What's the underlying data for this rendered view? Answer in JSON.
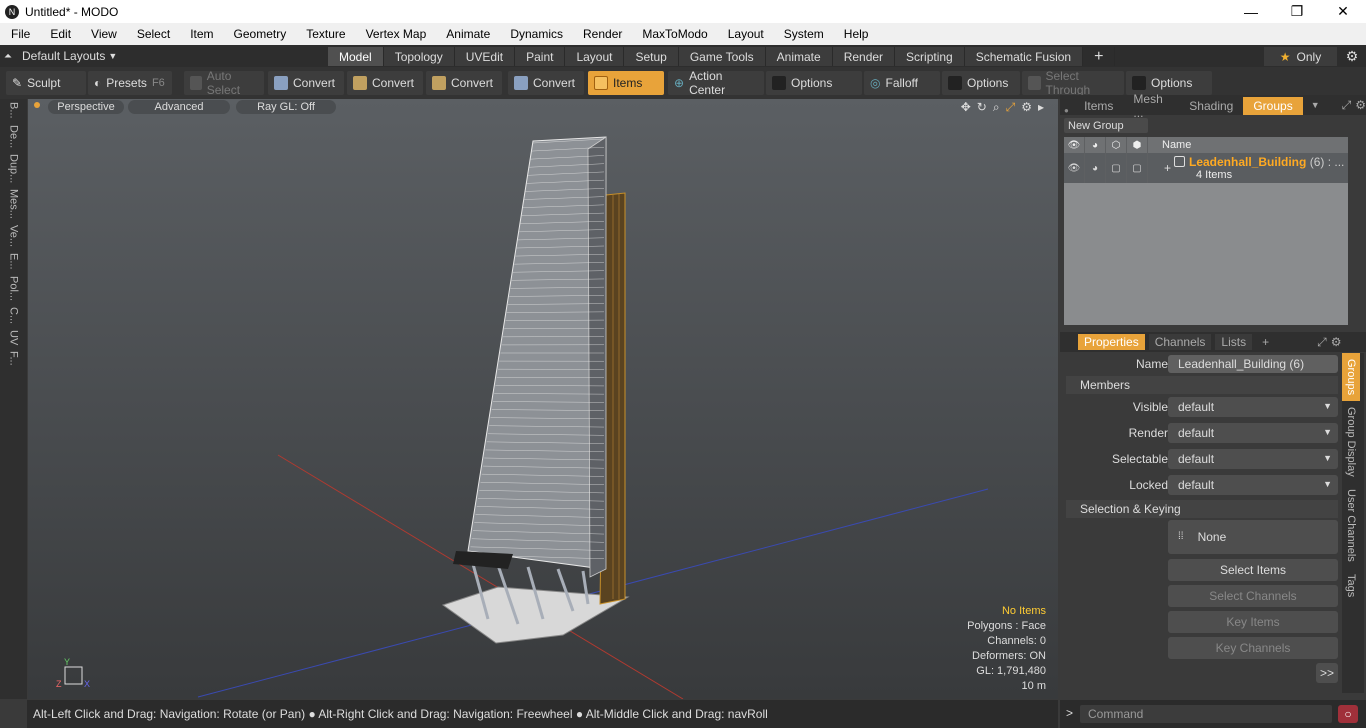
{
  "window": {
    "title": "Untitled* - MODO",
    "logo": "N"
  },
  "menu": [
    "File",
    "Edit",
    "View",
    "Select",
    "Item",
    "Geometry",
    "Texture",
    "Vertex Map",
    "Animate",
    "Dynamics",
    "Render",
    "MaxToModo",
    "Layout",
    "System",
    "Help"
  ],
  "layout_bar": {
    "default_layouts": "Default Layouts",
    "tabs": [
      "Model",
      "Topology",
      "UVEdit",
      "Paint",
      "Layout",
      "Setup",
      "Game Tools",
      "Animate",
      "Render",
      "Scripting",
      "Schematic Fusion"
    ],
    "active_tab": "Model",
    "add": "+",
    "only": "Only"
  },
  "toolbar": {
    "sculpt": "Sculpt",
    "presets": "Presets",
    "presets_key": "F6",
    "auto_select": "Auto Select",
    "convert": "Convert",
    "items": "Items",
    "action_center": "Action Center",
    "options": "Options",
    "falloff": "Falloff",
    "select_through": "Select Through"
  },
  "left_strip": [
    "B...",
    "De...",
    "Dup...",
    "Mes...",
    "Ve...",
    "E...",
    "Pol...",
    "C...",
    "UV",
    "F..."
  ],
  "viewport": {
    "perspective": "Perspective",
    "advanced": "Advanced",
    "raygl": "Ray GL: Off",
    "stats": {
      "no_items": "No Items",
      "polygons": "Polygons : Face",
      "channels": "Channels: 0",
      "deformers": "Deformers: ON",
      "gl": "GL: 1,791,480",
      "scale": "10 m"
    }
  },
  "status": "Alt-Left Click and Drag: Navigation: Rotate (or Pan) ● Alt-Right Click and Drag: Navigation: Freewheel ● Alt-Middle Click and Drag: navRoll",
  "right_top": {
    "tabs": [
      "Items",
      "Mesh ...",
      "Shading",
      "Groups"
    ],
    "active_tab": "Groups",
    "new_group": "New Group",
    "name_header": "Name",
    "group_name": "Leadenhall_Building",
    "group_count": "(6) : ...",
    "group_sub": "4 Items"
  },
  "properties": {
    "tabs": [
      "Properties",
      "Channels",
      "Lists"
    ],
    "active_tab": "Properties",
    "add": "+",
    "name_label": "Name",
    "name_value": "Leadenhall_Building (6)",
    "members": "Members",
    "visible_label": "Visible",
    "visible": "default",
    "render_label": "Render",
    "render": "default",
    "selectable_label": "Selectable",
    "selectable": "default",
    "locked_label": "Locked",
    "locked": "default",
    "selection_keying": "Selection & Keying",
    "none": "None",
    "select_items": "Select Items",
    "select_channels": "Select Channels",
    "key_items": "Key Items",
    "key_channels": "Key Channels",
    "more": ">>"
  },
  "side_tabs": [
    "Groups",
    "Group Display",
    "User Channels",
    "Tags"
  ],
  "command": {
    "placeholder": "Command",
    "arrow": ">"
  }
}
